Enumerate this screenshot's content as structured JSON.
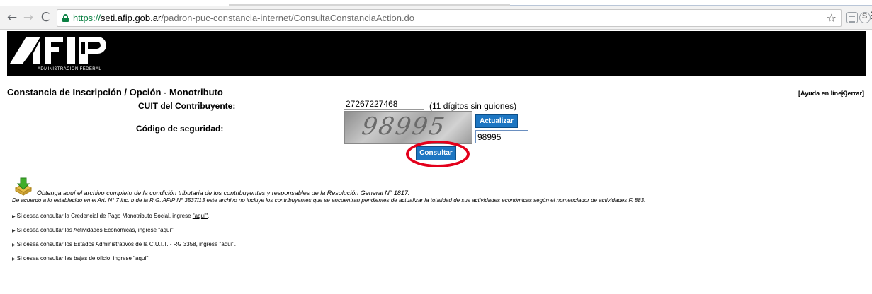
{
  "browser": {
    "url_scheme": "https://",
    "url_host": "seti.afip.gob.ar",
    "url_path": "/padron-puc-constancia-internet/ConsultaConstanciaAction.do",
    "nav_back": "←",
    "nav_forward": "→",
    "nav_reload": "C",
    "star": "☆",
    "menu": "⋮"
  },
  "header": {
    "logo_text": "AFIP",
    "subtitle": "ADMINISTRACION FEDERAL"
  },
  "page": {
    "title": "Constancia de Inscripción / Opción - Monotributo",
    "help_link": "[Ayuda en línea]",
    "close_link": "[Cerrar]"
  },
  "form": {
    "cuit_label": "CUIT del Contribuyente:",
    "cuit_value": "27267227468",
    "cuit_hint": "(11 dígitos sin guiones)",
    "codigo_label": "Código de seguridad:",
    "captcha_text": "98995",
    "actualizar_label": "Actualizar",
    "codigo_value": "98995",
    "consultar_label": "Consultar"
  },
  "download": {
    "link_text": "Obtenga aquí el archivo completo de la condición tributaria de los contribuyentes y responsables de la Resolución General N° 1817.",
    "note": "De acuerdo a lo establecido en el Art. N° 7 inc. b de la R.G. AFIP N° 3537/13 este archivo no incluye los contribuyentes que se encuentran pendientes de actualizar la totalidad de sus actividades económicas según el nomenclador de actividades F. 883."
  },
  "links": [
    {
      "text": "Si desea consultar la Credencial de Pago Monotributo Social, ingrese ",
      "link": "\"aquí\"",
      "suffix": "."
    },
    {
      "text": "Si desea consultar las Actividades Económicas, ingrese ",
      "link": "\"aquí\"",
      "suffix": "."
    },
    {
      "text": "Si desea consultar los Estados Administrativos de la C.U.I.T. - RG 3358, ingrese ",
      "link": "\"aquí\"",
      "suffix": "."
    },
    {
      "text": "Si desea consultar las bajas de oficio, ingrese ",
      "link": "\"aquí\"",
      "suffix": "."
    }
  ],
  "colors": {
    "button_blue": "#1d76c2",
    "highlight_red": "#e3001b",
    "secure_green": "#0b8043"
  }
}
